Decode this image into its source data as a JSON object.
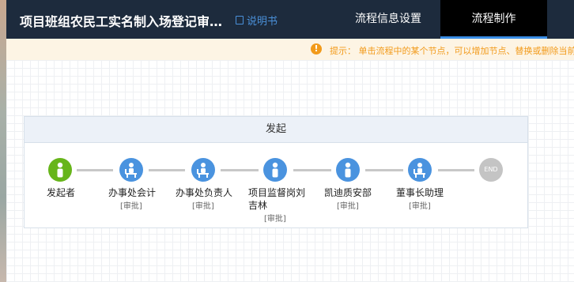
{
  "header": {
    "title": "项目班组农民工实名制入场登记审…",
    "manual_label": "说明书",
    "tabs": [
      {
        "label": "流程信息设置",
        "active": false
      },
      {
        "label": "流程制作",
        "active": true
      }
    ]
  },
  "tip": {
    "icon": "!",
    "text": "提示： 单击流程中的某个节点，可以增加节点、替换或删除当前节"
  },
  "flow": {
    "panel_title": "发起",
    "nodes": [
      {
        "label": "发起者",
        "sub": "",
        "type": "person",
        "color": "#67b51a"
      },
      {
        "label": "办事处会计",
        "sub": "[审批]",
        "type": "approver",
        "color": "#4a93df"
      },
      {
        "label": "办事处负责人",
        "sub": "[审批]",
        "type": "approver",
        "color": "#4a93df"
      },
      {
        "label": "项目监督岗刘",
        "label2": "吉林",
        "sub": "[审批]",
        "type": "person",
        "color": "#4a93df"
      },
      {
        "label": "凯迪质安部",
        "sub": "[审批]",
        "type": "person",
        "color": "#4a93df"
      },
      {
        "label": "董事长助理",
        "sub": "[审批]",
        "type": "approver",
        "color": "#4a93df"
      },
      {
        "label": "END",
        "sub": "",
        "type": "end",
        "color": "#c4c4c4"
      }
    ]
  },
  "colors": {
    "header_bg": "#1d2b3d",
    "accent": "#3a8ee6",
    "tip": "#f29a1a",
    "node_blue": "#4a93df",
    "node_green": "#67b51a"
  }
}
